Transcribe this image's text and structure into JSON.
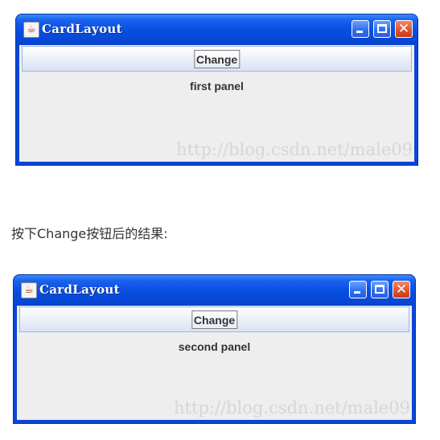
{
  "screenshots": [
    {
      "window_title": "CardLayout",
      "button_label": "Change",
      "panel_text": "first panel",
      "watermark": "http://blog.csdn.net/male09"
    },
    {
      "window_title": "CardLayout",
      "button_label": "Change",
      "panel_text": "second panel",
      "watermark": "http://blog.csdn.net/male09"
    }
  ],
  "caption": "按下Change按钮后的结果:",
  "colors": {
    "titlebar": "#0a4fe0",
    "client_bg": "#eeeeee",
    "close_button": "#e0502c"
  },
  "icons": [
    "java-cup-icon",
    "minimize-icon",
    "maximize-icon",
    "close-icon"
  ]
}
